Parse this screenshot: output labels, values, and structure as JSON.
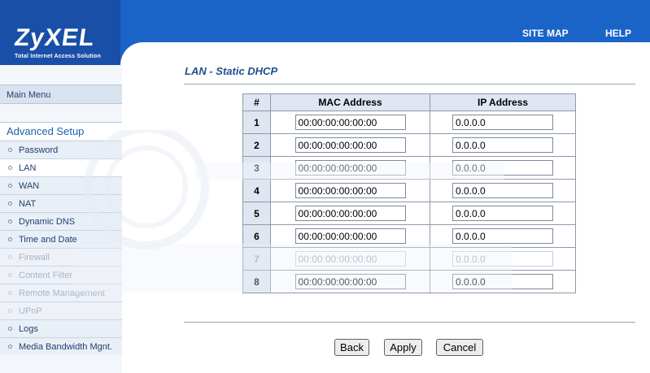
{
  "logo": {
    "name": "ZyXEL",
    "tagline": "Total Internet Access Solution"
  },
  "topnav": {
    "site_map": "SITE MAP",
    "help": "HELP"
  },
  "sidebar": {
    "main_menu": "Main Menu",
    "section": "Advanced Setup",
    "items": [
      {
        "label": "Password"
      },
      {
        "label": "LAN"
      },
      {
        "label": "WAN"
      },
      {
        "label": "NAT"
      },
      {
        "label": "Dynamic DNS"
      },
      {
        "label": "Time and Date"
      },
      {
        "label": "Firewall"
      },
      {
        "label": "Content Filter"
      },
      {
        "label": "Remote Management"
      },
      {
        "label": "UPnP"
      },
      {
        "label": "Logs"
      },
      {
        "label": "Media Bandwidth Mgnt."
      }
    ]
  },
  "page": {
    "title": "LAN - Static DHCP"
  },
  "table": {
    "headers": [
      "#",
      "MAC Address",
      "IP Address"
    ],
    "rows": [
      {
        "num": "1",
        "mac": "00:00:00:00:00:00",
        "ip": "0.0.0.0"
      },
      {
        "num": "2",
        "mac": "00:00:00:00:00:00",
        "ip": "0.0.0.0"
      },
      {
        "num": "3",
        "mac": "00:00:00:00:00:00",
        "ip": "0.0.0.0"
      },
      {
        "num": "4",
        "mac": "00:00:00:00:00:00",
        "ip": "0.0.0.0"
      },
      {
        "num": "5",
        "mac": "00:00:00:00:00:00",
        "ip": "0.0.0.0"
      },
      {
        "num": "6",
        "mac": "00:00:00:00:00:00",
        "ip": "0.0.0.0"
      },
      {
        "num": "7",
        "mac": "00:00:00:00:00:00",
        "ip": "0.0.0.0"
      },
      {
        "num": "8",
        "mac": "00:00:00:00:00:00",
        "ip": "0.0.0.0"
      }
    ]
  },
  "buttons": {
    "back": "Back",
    "apply": "Apply",
    "cancel": "Cancel"
  },
  "colors": {
    "banner": "#1a64c8",
    "title": "#1f4f8f",
    "header_cell": "#dfe6f1"
  }
}
